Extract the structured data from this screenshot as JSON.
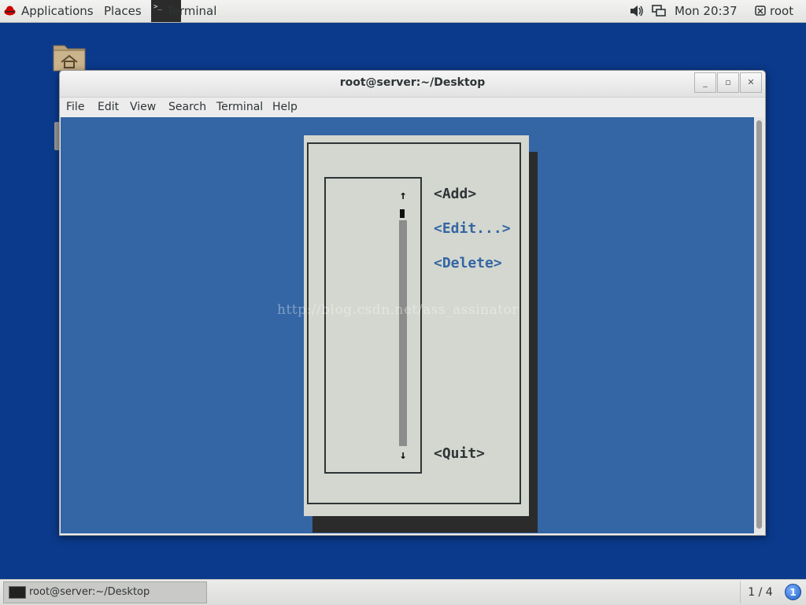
{
  "top_panel": {
    "applications_label": "Applications",
    "places_label": "Places",
    "active_app_label": "Terminal",
    "clock": "Mon 20:37",
    "user_label": "root"
  },
  "window": {
    "title": "root@server:~/Desktop",
    "minimize_glyph": "_",
    "maximize_glyph": "▫",
    "close_glyph": "✕",
    "menu": [
      "File",
      "Edit",
      "View",
      "Search",
      "Terminal",
      "Help"
    ]
  },
  "tui_dialog": {
    "buttons": {
      "add": "<Add>",
      "edit": "<Edit...>",
      "delete": "<Delete>",
      "quit": "<Quit>"
    },
    "scroll_up_glyph": "↑",
    "scroll_down_glyph": "↓",
    "colors": {
      "dialog_bg": "#d3d7cf",
      "terminal_bg": "#3465a4",
      "disabled_button": "#3465a4",
      "enabled_button": "#2e3436"
    }
  },
  "watermark": "http://blog.csdn.net/ass_assinator",
  "bottom_panel": {
    "task_label": "root@server:~/Desktop",
    "workspace": "1 / 4",
    "notification_count": "1"
  },
  "icons": [
    "redhat-icon",
    "terminal-icon",
    "volume-icon",
    "network-icon",
    "user-icon",
    "home-folder-icon"
  ]
}
